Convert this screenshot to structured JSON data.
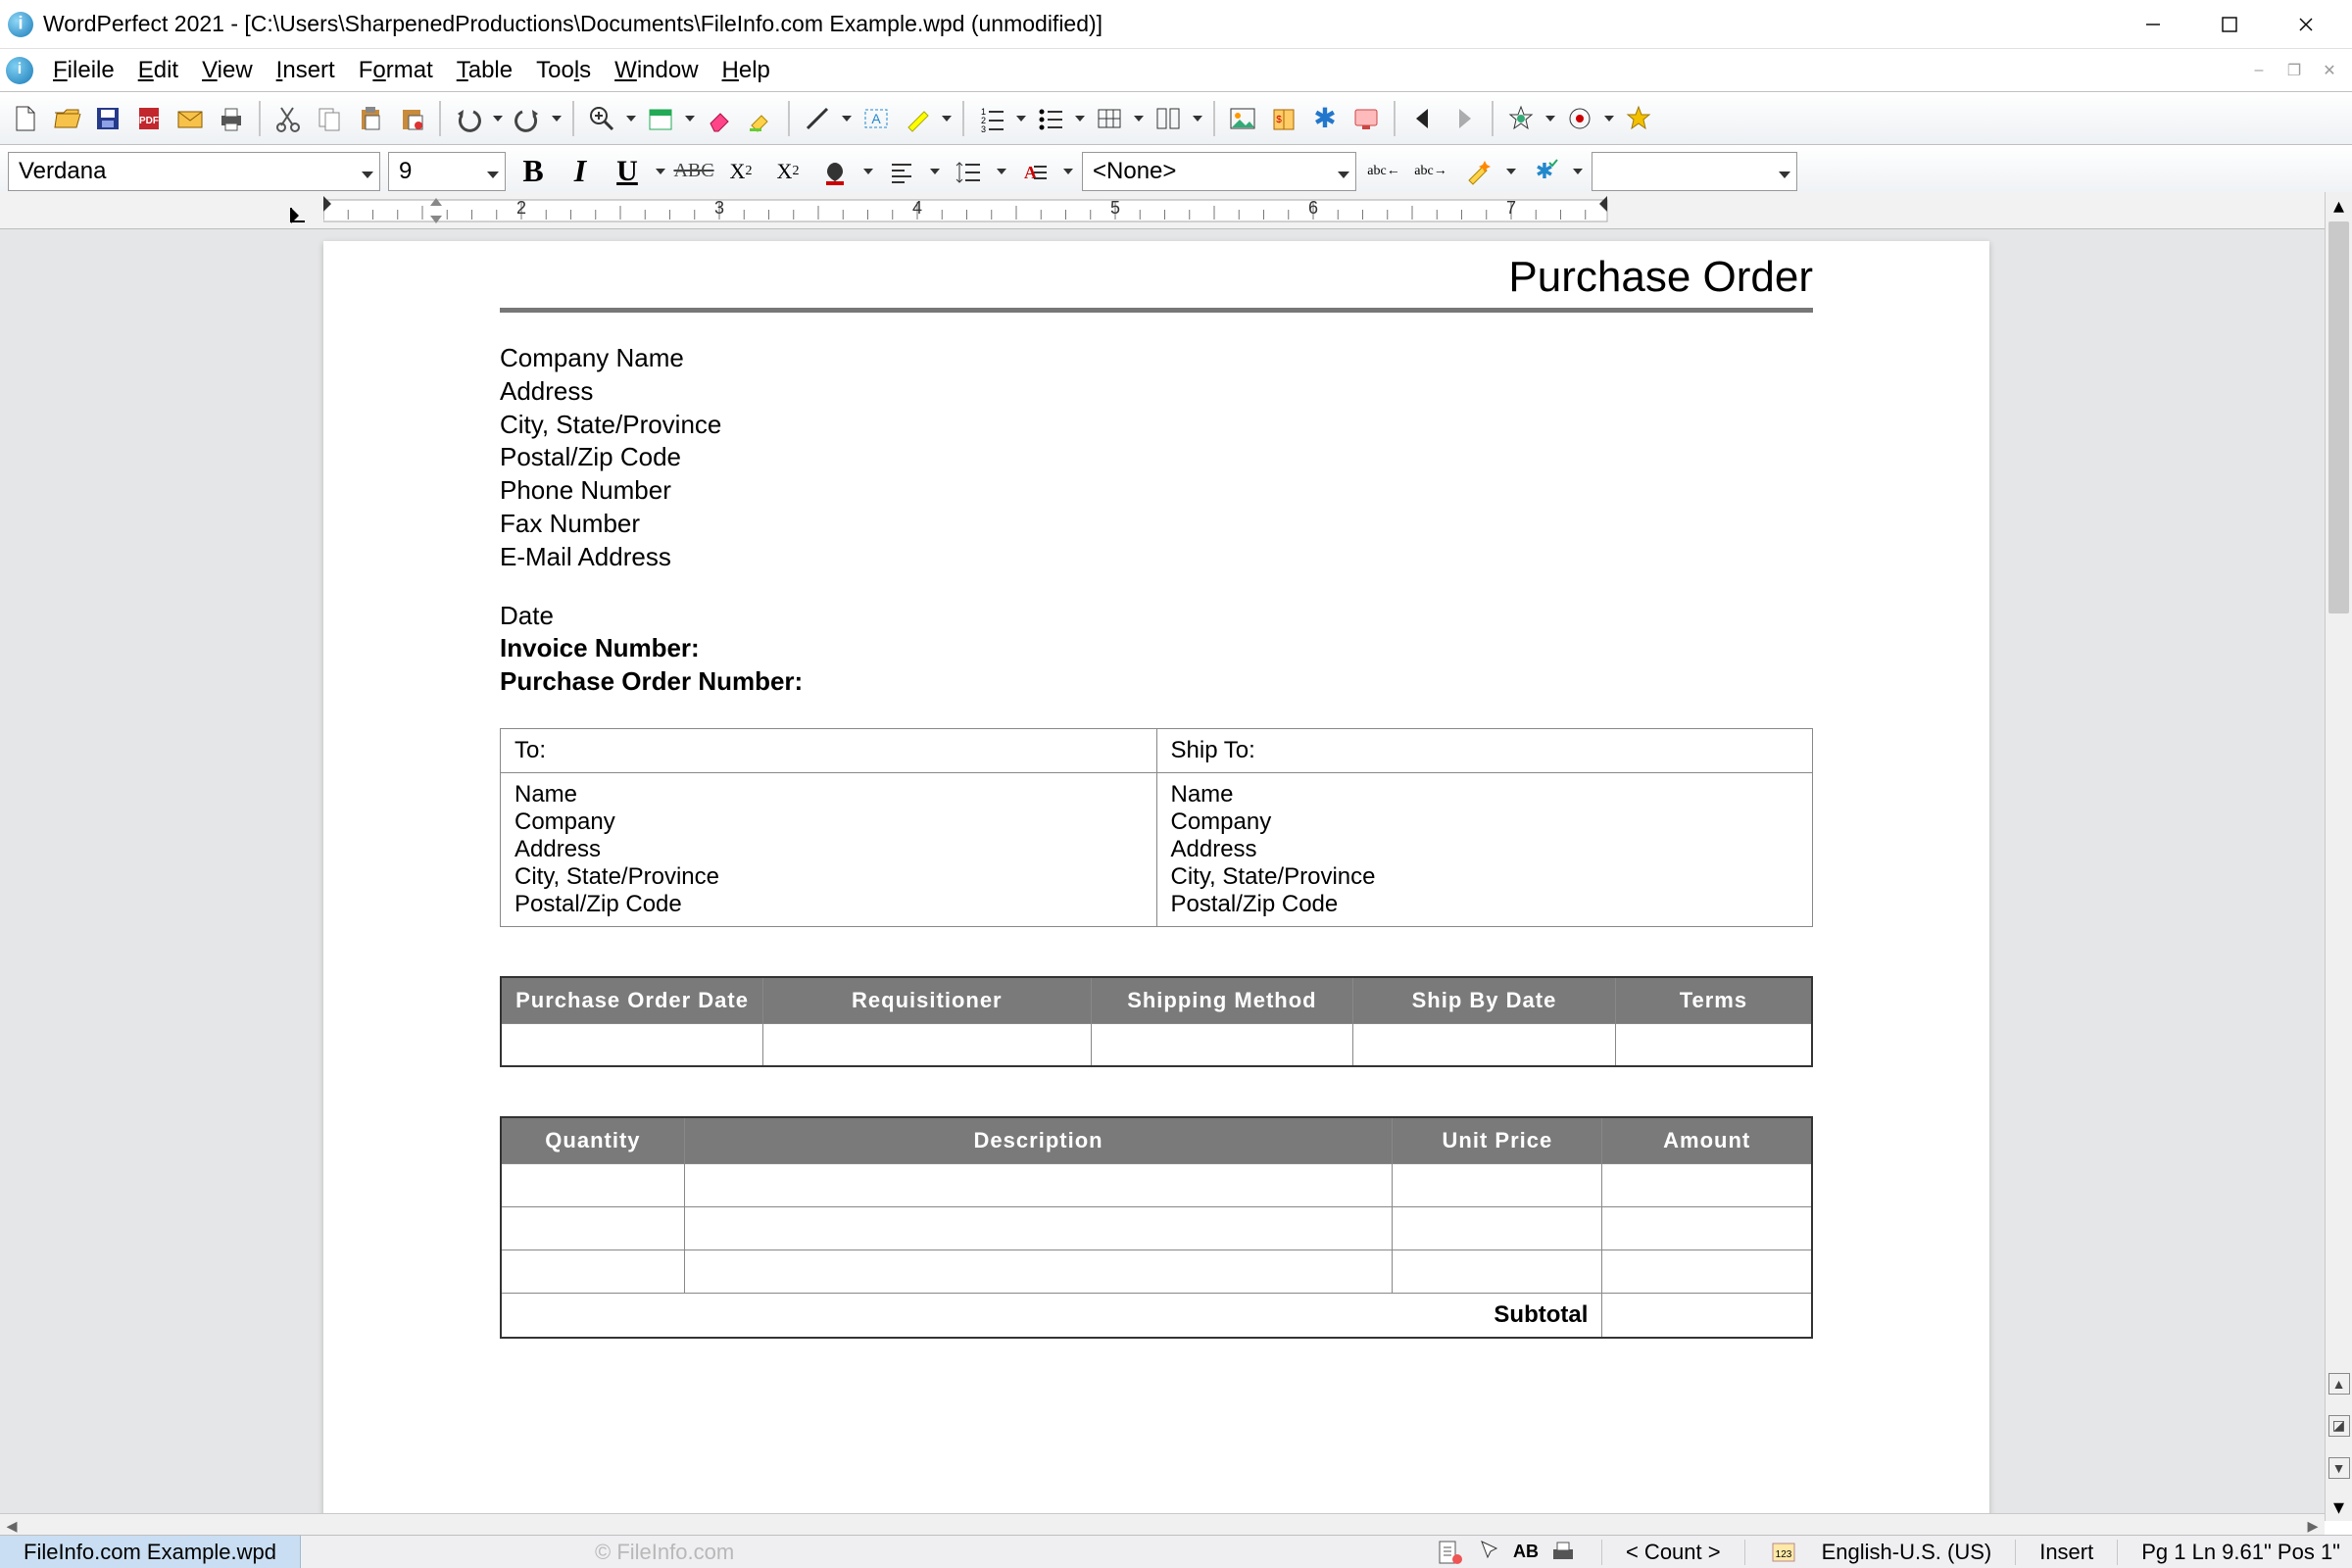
{
  "window": {
    "title": "WordPerfect 2021 - [C:\\Users\\SharpenedProductions\\Documents\\FileInfo.com Example.wpd (unmodified)]"
  },
  "menu": {
    "items": [
      "File",
      "Edit",
      "View",
      "Insert",
      "Format",
      "Table",
      "Tools",
      "Window",
      "Help"
    ]
  },
  "font": {
    "name": "Verdana",
    "size": "9",
    "style_combo": "<None>"
  },
  "ruler": {
    "numbers": [
      "2",
      "3",
      "4",
      "5",
      "6",
      "7"
    ]
  },
  "doc": {
    "title": "Purchase Order",
    "company_block": [
      "Company Name",
      "Address",
      "City, State/Province",
      "Postal/Zip Code",
      "Phone Number",
      "Fax Number",
      "E-Mail Address"
    ],
    "date_line": "Date",
    "invoice_line": "Invoice Number:",
    "po_line": "Purchase Order Number:",
    "to_header": "To:",
    "ship_header": "Ship To:",
    "to_block": [
      "Name",
      "Company",
      "Address",
      "City, State/Province",
      "Postal/Zip Code"
    ],
    "ship_block": [
      "Name",
      "Company",
      "Address",
      "City, State/Province",
      "Postal/Zip Code"
    ],
    "order_headers": [
      "Purchase Order Date",
      "Requisitioner",
      "Shipping Method",
      "Ship By Date",
      "Terms"
    ],
    "items_headers": [
      "Quantity",
      "Description",
      "Unit Price",
      "Amount"
    ],
    "subtotal": "Subtotal"
  },
  "status": {
    "tab": "FileInfo.com Example.wpd",
    "watermark": "© FileInfo.com",
    "count": "< Count >",
    "lang": "English-U.S. (US)",
    "mode": "Insert",
    "pos": "Pg 1 Ln 9.61\" Pos 1\""
  }
}
